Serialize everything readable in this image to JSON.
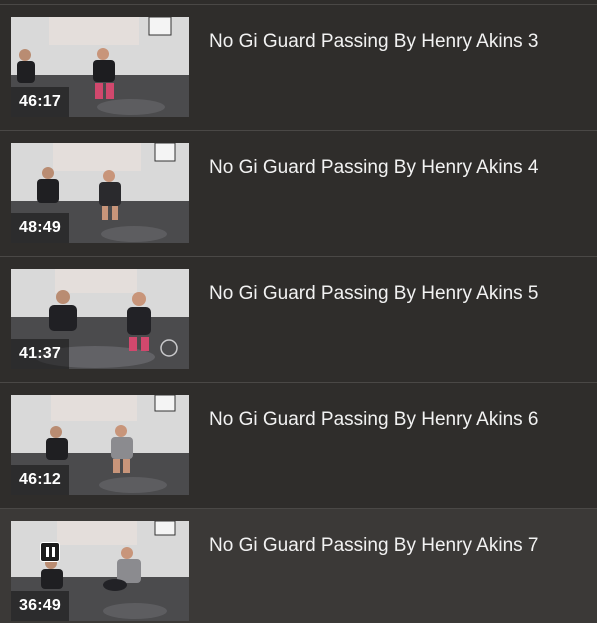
{
  "playlist": {
    "items": [
      {
        "title": "No Gi Guard Passing By Henry Akins 3",
        "duration": "46:17",
        "playing": false
      },
      {
        "title": "No Gi Guard Passing By Henry Akins 4",
        "duration": "48:49",
        "playing": false
      },
      {
        "title": "No Gi Guard Passing By Henry Akins 5",
        "duration": "41:37",
        "playing": false
      },
      {
        "title": "No Gi Guard Passing By Henry Akins 6",
        "duration": "46:12",
        "playing": false
      },
      {
        "title": "No Gi Guard Passing By Henry Akins 7",
        "duration": "36:49",
        "playing": true
      }
    ],
    "colors": {
      "background": "#2f2d2b",
      "active_row": "#3b3937",
      "divider": "#4a4846",
      "title_text": "#f2f2f2",
      "mat": "#4b4b4d",
      "wall": "#d9d9d9",
      "curtain": "#e4dedb"
    },
    "icons": {
      "now_playing": "pause-icon"
    }
  }
}
